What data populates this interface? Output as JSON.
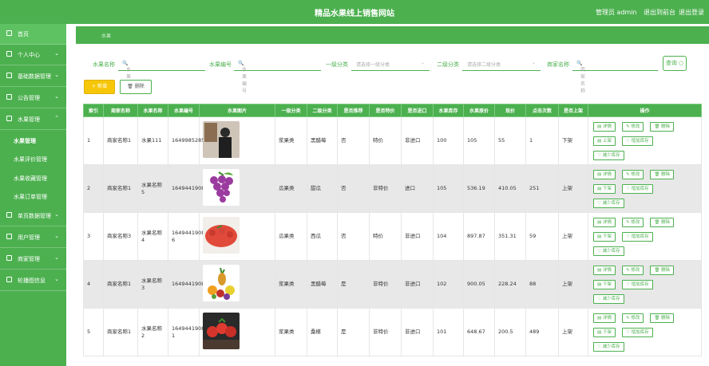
{
  "header": {
    "title": "精品水果线上销售网站",
    "admin": "管理员 admin",
    "back": "退出到前台",
    "logout": "退出登录"
  },
  "sidebar": {
    "home": "首页",
    "groups": [
      {
        "label": "个人中心"
      },
      {
        "label": "基础数据管理"
      },
      {
        "label": "公告管理"
      },
      {
        "label": "水果管理"
      }
    ],
    "sub": [
      "水果管理",
      "水果评价管理",
      "水果收藏管理",
      "水果订单管理"
    ],
    "groups2": [
      {
        "label": "单页数据管理"
      },
      {
        "label": "用户管理"
      },
      {
        "label": "商家管理"
      },
      {
        "label": "轮播图信息"
      }
    ]
  },
  "breadcrumb": "水果",
  "search": {
    "name_label": "水果名称",
    "name_ph": "水果名称",
    "code_label": "水果编号",
    "code_ph": "水果编号",
    "cat1_label": "一级分类",
    "cat1_ph": "请选择一级分类",
    "cat2_label": "二级分类",
    "cat2_ph": "请选择二级分类",
    "shop_label": "商家名称",
    "shop_ph": "商家名称",
    "query": "查询"
  },
  "actions": {
    "add": "+ 新增",
    "del": "删除"
  },
  "table": {
    "headers": [
      "索引",
      "商家名称",
      "水果名称",
      "水果编号",
      "水果图片",
      "一级分类",
      "二级分类",
      "是否推荐",
      "是否特价",
      "是否进口",
      "水果库存",
      "水果原价",
      "现价",
      "点击次数",
      "是否上架",
      "操作"
    ],
    "rows": [
      {
        "idx": "1",
        "shop": "商家名称1",
        "name": "水果111",
        "code": "1649985285335",
        "cat1": "浆果类",
        "cat2": "黑醋莓",
        "rec": "否",
        "special": "特价",
        "import": "非进口",
        "stock": "100",
        "price": "105",
        "now": "55",
        "clicks": "1",
        "shelf": "下架",
        "toggle": "上架",
        "img": "photo"
      },
      {
        "idx": "2",
        "shop": "商家名称1",
        "name": "水果名称5",
        "code": "16494419082580",
        "cat1": "瓜果类",
        "cat2": "甜瓜",
        "rec": "否",
        "special": "非特价",
        "import": "进口",
        "stock": "105",
        "price": "536.19",
        "now": "410.05",
        "clicks": "251",
        "shelf": "上架",
        "toggle": "下架",
        "img": "grape"
      },
      {
        "idx": "3",
        "shop": "商家名称3",
        "name": "水果名称4",
        "code": "16494419082581 6",
        "cat1": "瓜果类",
        "cat2": "西瓜",
        "rec": "否",
        "special": "特价",
        "import": "非进口",
        "stock": "104",
        "price": "897.87",
        "now": "351.31",
        "clicks": "59",
        "shelf": "上架",
        "toggle": "下架",
        "img": "tomato"
      },
      {
        "idx": "4",
        "shop": "商家名称1",
        "name": "水果名称3",
        "code": "16494419082582",
        "cat1": "浆果类",
        "cat2": "黑醋莓",
        "rec": "是",
        "special": "非特价",
        "import": "非进口",
        "stock": "102",
        "price": "900.05",
        "now": "228.24",
        "clicks": "88",
        "shelf": "上架",
        "toggle": "下架",
        "img": "fruitmix"
      },
      {
        "idx": "5",
        "shop": "商家名称1",
        "name": "水果名称2",
        "code": "16494419082581 1",
        "cat1": "浆果类",
        "cat2": "桑椹",
        "rec": "是",
        "special": "非特价",
        "import": "非进口",
        "stock": "101",
        "price": "648.67",
        "now": "200.5",
        "clicks": "489",
        "shelf": "上架",
        "toggle": "下架",
        "img": "berries"
      }
    ],
    "ops": {
      "detail": "详情",
      "edit": "修改",
      "delete": "删除",
      "addstock": "增加库存",
      "reducestock": "减少库存"
    }
  },
  "colors": {
    "brand": "#4cb04f",
    "accent": "#f6c709"
  }
}
